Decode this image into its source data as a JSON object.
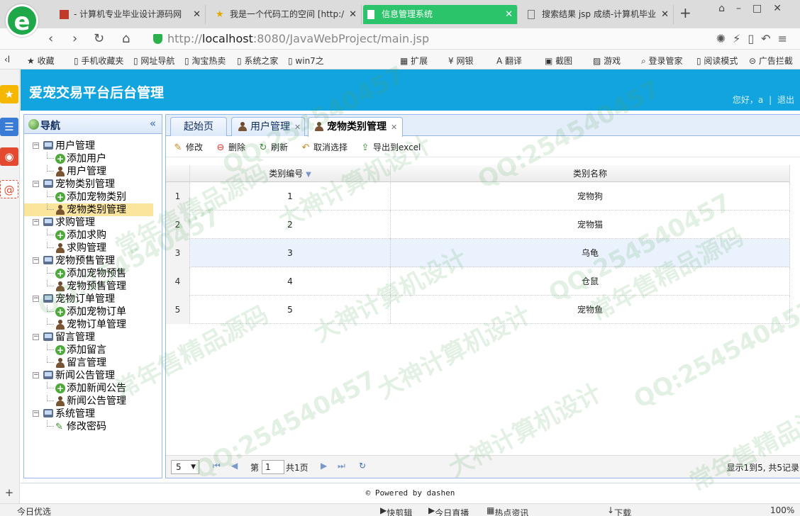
{
  "browser": {
    "tabs": [
      {
        "title": "- 计算机专业毕业设计源码网"
      },
      {
        "title": "我是一个代码工的空间 [http:/"
      },
      {
        "title": "信息管理系统"
      },
      {
        "title": "搜索结果 jsp 成绩-计算机毕业"
      }
    ],
    "url_prefix": "http://",
    "url_host": "localhost",
    "url_rest": ":8080/JavaWebProject/main.jsp",
    "favorites": [
      "收藏",
      "手机收藏夹",
      "网址导航",
      "淘宝热卖",
      "系统之家",
      "win7之"
    ],
    "extensions": [
      "扩展",
      "网银",
      "翻译",
      "截图",
      "游戏",
      "登录管家",
      "阅读模式",
      "广告拦截"
    ],
    "status_left": "今日优选",
    "status_items": [
      "快剪辑",
      "今日直播",
      "热点资讯",
      "下载"
    ],
    "zoom": "100%"
  },
  "app": {
    "title": "爱宠交易平台后台管理",
    "greeting": "您好，a",
    "separator": "|",
    "logout": "退出",
    "footer": "© Powered by dashen"
  },
  "nav": {
    "title": "导航",
    "collapse": "«",
    "tree": [
      {
        "label": "用户管理",
        "children": [
          {
            "label": "添加用户",
            "icon": "add-icon"
          },
          {
            "label": "用户管理",
            "icon": "user-icon"
          }
        ]
      },
      {
        "label": "宠物类别管理",
        "children": [
          {
            "label": "添加宠物类别",
            "icon": "add-icon"
          },
          {
            "label": "宠物类别管理",
            "icon": "user-icon",
            "selected": true
          }
        ]
      },
      {
        "label": "求购管理",
        "children": [
          {
            "label": "添加求购",
            "icon": "add-icon"
          },
          {
            "label": "求购管理",
            "icon": "user-icon"
          }
        ]
      },
      {
        "label": "宠物预售管理",
        "children": [
          {
            "label": "添加宠物预售",
            "icon": "add-icon"
          },
          {
            "label": "宠物预售管理",
            "icon": "user-icon"
          }
        ]
      },
      {
        "label": "宠物订单管理",
        "children": [
          {
            "label": "添加宠物订单",
            "icon": "add-icon"
          },
          {
            "label": "宠物订单管理",
            "icon": "user-icon"
          }
        ]
      },
      {
        "label": "留言管理",
        "children": [
          {
            "label": "添加留言",
            "icon": "add-icon"
          },
          {
            "label": "留言管理",
            "icon": "user-icon"
          }
        ]
      },
      {
        "label": "新闻公告管理",
        "children": [
          {
            "label": "添加新闻公告",
            "icon": "add-icon"
          },
          {
            "label": "新闻公告管理",
            "icon": "user-icon"
          }
        ]
      },
      {
        "label": "系统管理",
        "children": [
          {
            "label": "修改密码",
            "icon": "pencil-icon"
          }
        ]
      }
    ]
  },
  "content_tabs": [
    {
      "label": "起始页"
    },
    {
      "label": "用户管理"
    },
    {
      "label": "宠物类别管理"
    }
  ],
  "toolbar": {
    "edit": "修改",
    "delete": "删除",
    "refresh": "刷新",
    "unselect": "取消选择",
    "export": "导出到excel"
  },
  "grid": {
    "columns": [
      "类别编号",
      "类别名称"
    ],
    "rows": [
      {
        "num": "1",
        "id": "1",
        "name": "宠物狗"
      },
      {
        "num": "2",
        "id": "2",
        "name": "宠物猫"
      },
      {
        "num": "3",
        "id": "3",
        "name": "乌龟"
      },
      {
        "num": "4",
        "id": "4",
        "name": "仓鼠"
      },
      {
        "num": "5",
        "id": "5",
        "name": "宠物鱼"
      }
    ]
  },
  "pager": {
    "page_size": "5",
    "page_prefix": "第",
    "page_value": "1",
    "page_suffix": "共1页",
    "info": "显示1到5, 共5记录"
  },
  "watermarks": [
    "QQ:254540457",
    "常年售精品源码",
    "大神计算机设计"
  ]
}
